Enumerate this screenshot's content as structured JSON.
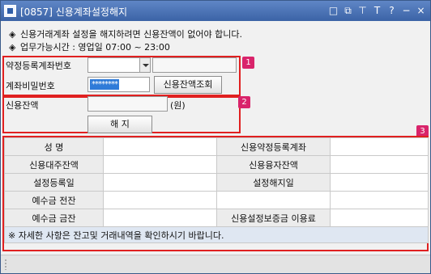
{
  "window": {
    "title": "[0857] 신용계좌설정해지"
  },
  "title_controls": [
    "□",
    "⧉",
    "⊤",
    "T",
    "?",
    "−",
    "×"
  ],
  "notices": [
    "신용거래계좌 설정을 해지하려면 신용잔액이 없어야 합니다.",
    "업무가능시간 : 영업일 07:00 ~ 23:00"
  ],
  "notice_bullet": "◈",
  "badges": [
    "1",
    "2",
    "3"
  ],
  "form": {
    "account_label": "약정등록계좌번호",
    "account_value": "",
    "account_name_value": "",
    "password_label": "계좌비밀번호",
    "password_value": "********",
    "balance_query_button": "신용잔액조회",
    "credit_balance_label": "신용잔액",
    "credit_balance_value": "",
    "unit_label": "(원)",
    "cancel_button": "해  지"
  },
  "grid": {
    "rows": [
      {
        "l1": "성 명",
        "v1": "",
        "l2": "신용약정등록계좌",
        "v2": ""
      },
      {
        "l1": "신용대주잔액",
        "v1": "",
        "l2": "신용융자잔액",
        "v2": ""
      },
      {
        "l1": "설정등록일",
        "v1": "",
        "l2": "설정해지일",
        "v2": ""
      },
      {
        "l1": "예수금 전잔",
        "v1": "",
        "l2": "",
        "v2": ""
      },
      {
        "l1": "예수금 금잔",
        "v1": "",
        "l2": "신용설정보증금 이용료",
        "v2": ""
      }
    ],
    "footer_note": "※ 자세한 사항은 잔고및 거래내역을 확인하시기 바랍니다."
  },
  "colors": {
    "titlebar": "#4a72b6",
    "highlight_box": "#e02020",
    "badge": "#d9246b",
    "selection": "#2f7bd8"
  }
}
